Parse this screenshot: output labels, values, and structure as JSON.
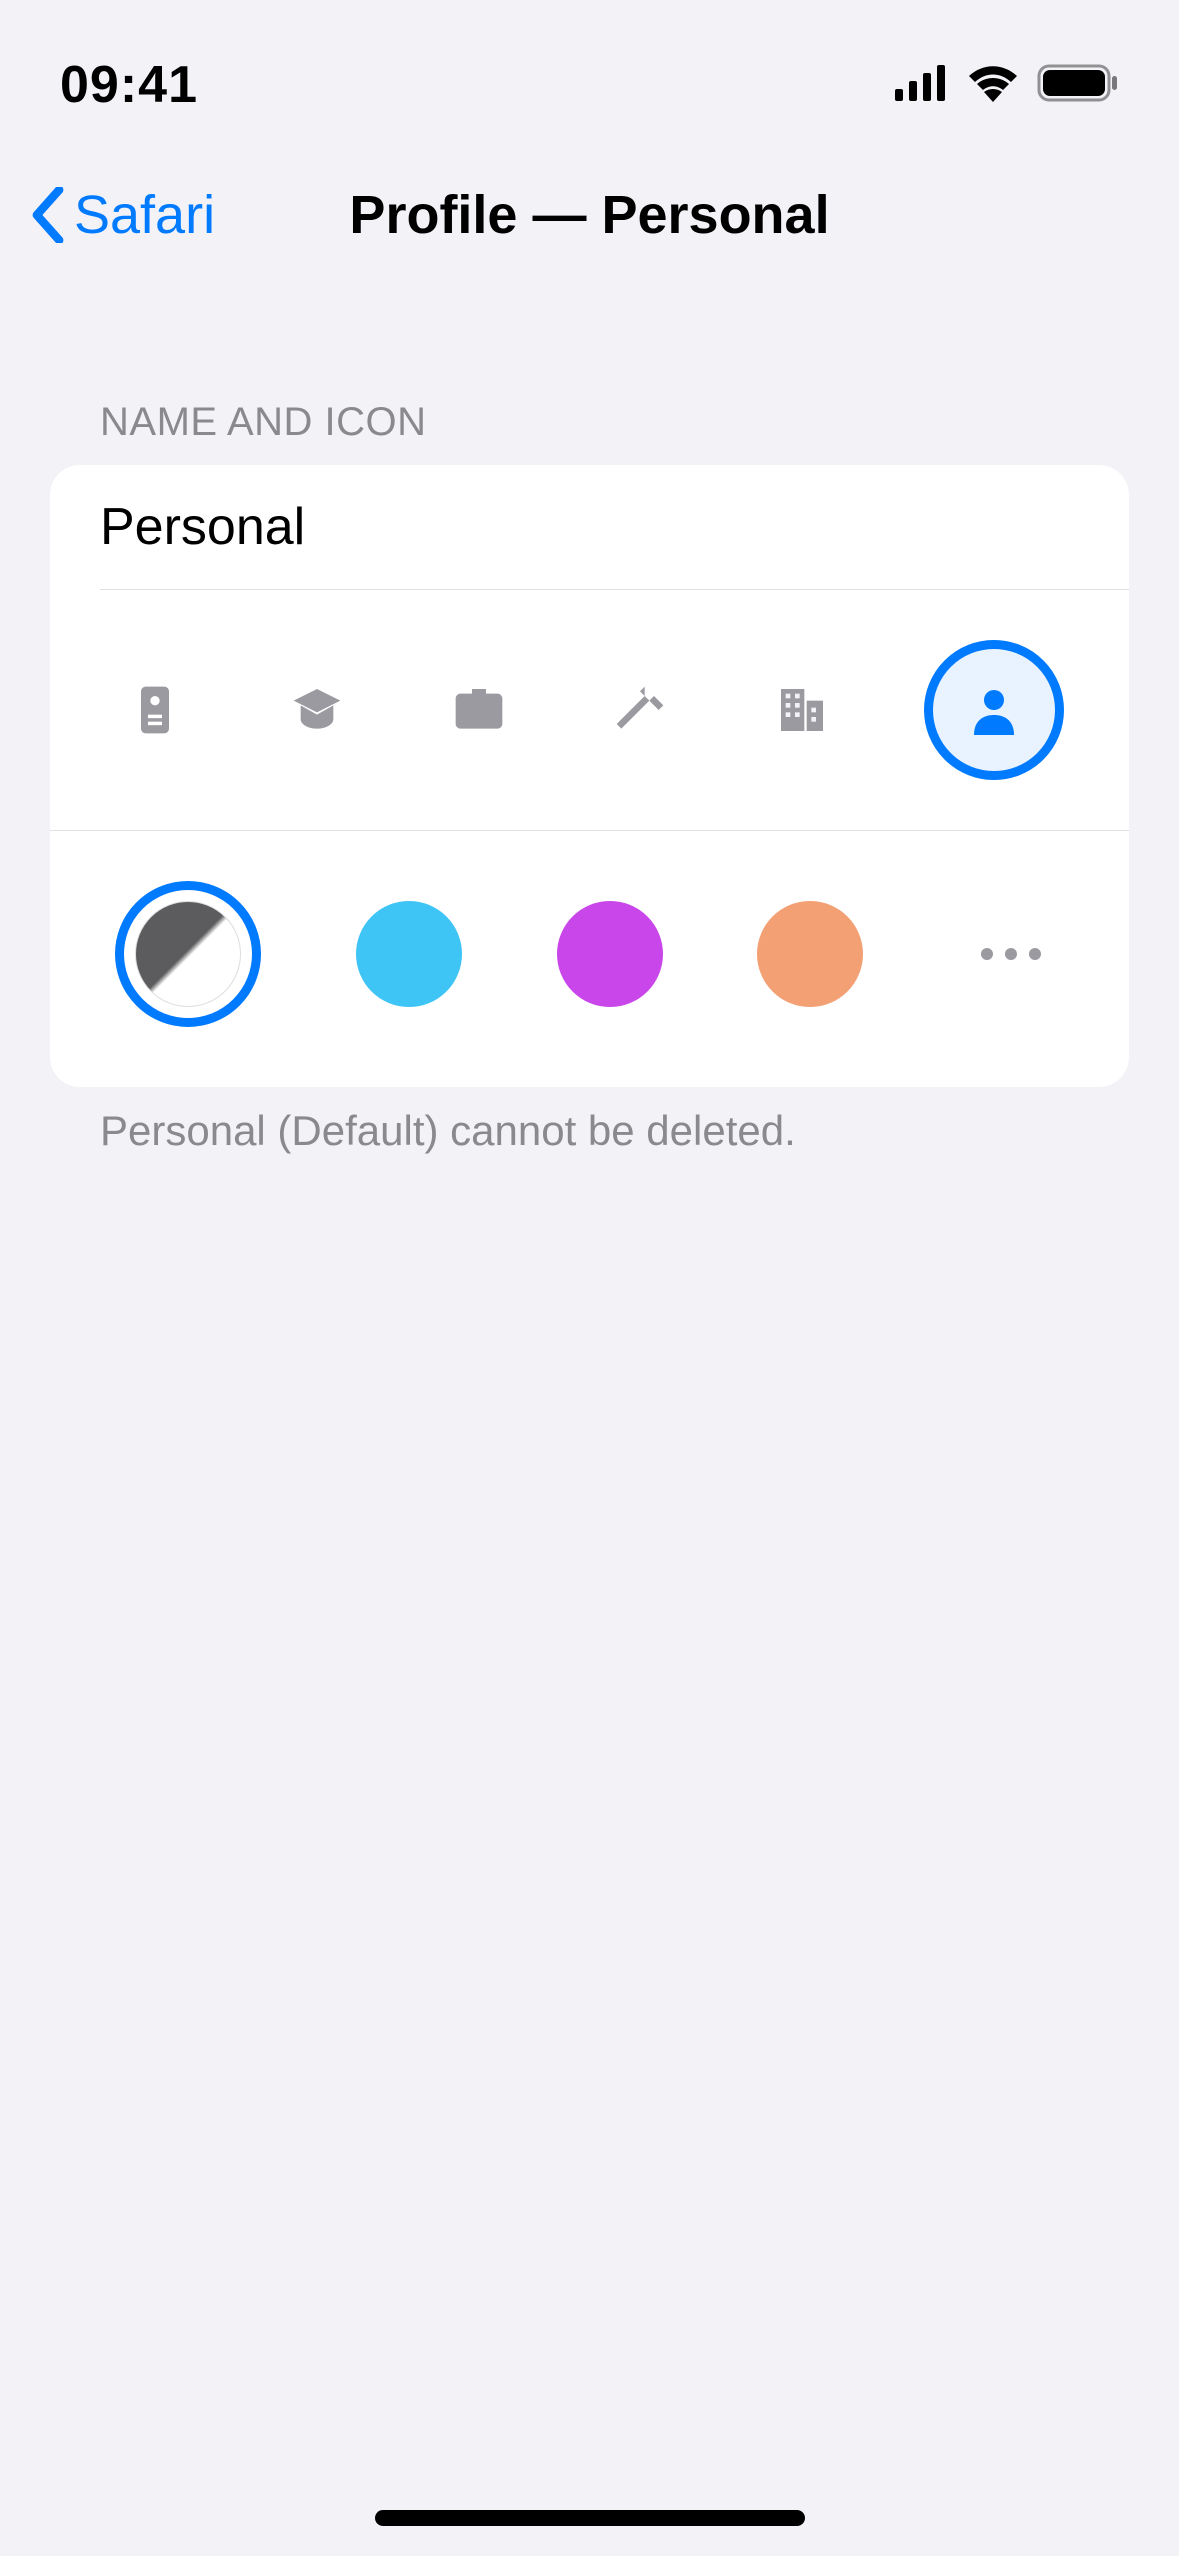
{
  "status": {
    "time": "09:41"
  },
  "nav": {
    "back_label": "Safari",
    "title": "Profile — Personal"
  },
  "section": {
    "header": "Name and Icon",
    "name_value": "Personal",
    "footer": "Personal (Default) cannot be deleted."
  },
  "icons": [
    {
      "id": "badge"
    },
    {
      "id": "graduation"
    },
    {
      "id": "briefcase"
    },
    {
      "id": "hammer"
    },
    {
      "id": "building"
    },
    {
      "id": "person",
      "selected": true
    }
  ],
  "colors": [
    {
      "id": "default",
      "hex": "#5c5c5e",
      "selected": true
    },
    {
      "id": "blue",
      "hex": "#3fc4f6"
    },
    {
      "id": "purple",
      "hex": "#c846ea"
    },
    {
      "id": "orange",
      "hex": "#f3a074"
    },
    {
      "id": "more"
    }
  ]
}
